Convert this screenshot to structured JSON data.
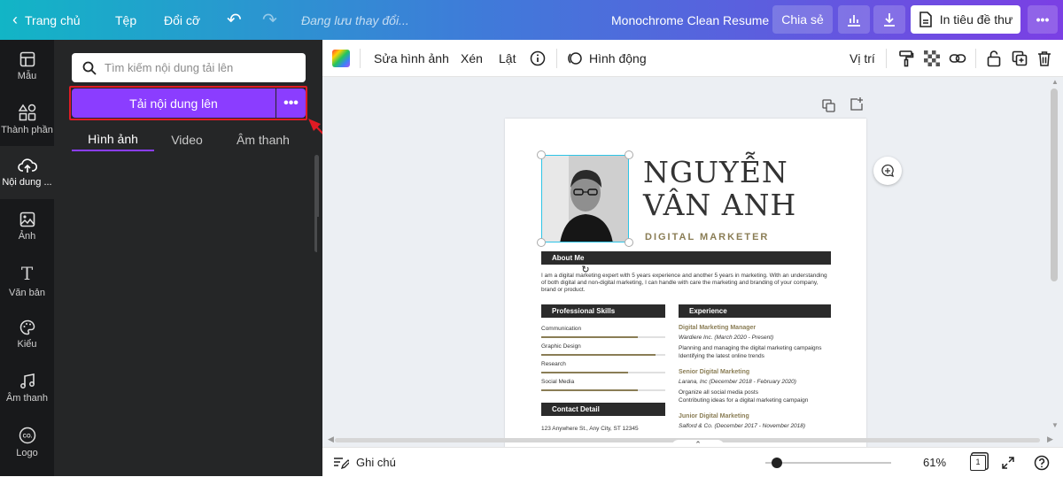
{
  "topbar": {
    "home": "Trang chủ",
    "file": "Tệp",
    "resize": "Đổi cỡ",
    "saving": "Đang lưu thay đổi...",
    "doc_title": "Monochrome Clean Resume",
    "share": "Chia sẻ",
    "print": "In tiêu đề thư"
  },
  "rail": {
    "items": [
      {
        "label": "Mẫu"
      },
      {
        "label": "Thành phần"
      },
      {
        "label": "Nội dung ..."
      },
      {
        "label": "Ảnh"
      },
      {
        "label": "Văn bản"
      },
      {
        "label": "Kiểu"
      },
      {
        "label": "Âm thanh"
      },
      {
        "label": "Logo"
      }
    ]
  },
  "panel": {
    "search_placeholder": "Tìm kiếm nội dung tải lên",
    "upload_button": "Tải nội dung lên",
    "tabs": [
      {
        "label": "Hình ảnh"
      },
      {
        "label": "Video"
      },
      {
        "label": "Âm thanh"
      }
    ]
  },
  "toolbar": {
    "edit_image": "Sửa hình ảnh",
    "crop": "Xén",
    "flip": "Lật",
    "animate": "Hình động",
    "position": "Vị trí"
  },
  "resume": {
    "name_line1": "NGUYỄN",
    "name_line2": "VÂN ANH",
    "role": "DIGITAL MARKETER",
    "about_title": "About Me",
    "about_text": "I am a digital marketing expert with 5 years experience and another 5 years in marketing. With an understanding of both digital and non-digital marketing, I can handle with care the marketing and branding of your company, brand or product.",
    "skills_title": "Professional Skills",
    "skills": [
      {
        "name": "Communication",
        "level": 0.78
      },
      {
        "name": "Graphic Design",
        "level": 0.92
      },
      {
        "name": "Research",
        "level": 0.7
      },
      {
        "name": "Social Media",
        "level": 0.78
      }
    ],
    "contact_title": "Contact Detail",
    "contact_address": "123 Anywhere St., Any City, ST 12345",
    "experience_title": "Experience",
    "jobs": [
      {
        "title": "Digital Marketing Manager",
        "sub": "Wardiere Inc. (March 2020 - Present)",
        "desc1": "Planning and managing the digital marketing campaigns",
        "desc2": "Identifying the latest online trends"
      },
      {
        "title": "Senior Digital Marketing",
        "sub": "Larana, Inc (December 2018 - February 2020)",
        "desc1": "Organize all social media posts",
        "desc2": "Contributing ideas for a digital marketing campaign"
      },
      {
        "title": "Junior Digital Marketing",
        "sub": "Salford & Co. (December 2017 - November 2018)",
        "desc1": "",
        "desc2": ""
      }
    ]
  },
  "bottombar": {
    "notes": "Ghi chú",
    "zoom": "61%",
    "page_num": "1",
    "zoom_level": 0.05
  },
  "colors": {
    "accent": "#8b3dff",
    "highlight": "#e01b24",
    "gold": "#8a7d55"
  }
}
